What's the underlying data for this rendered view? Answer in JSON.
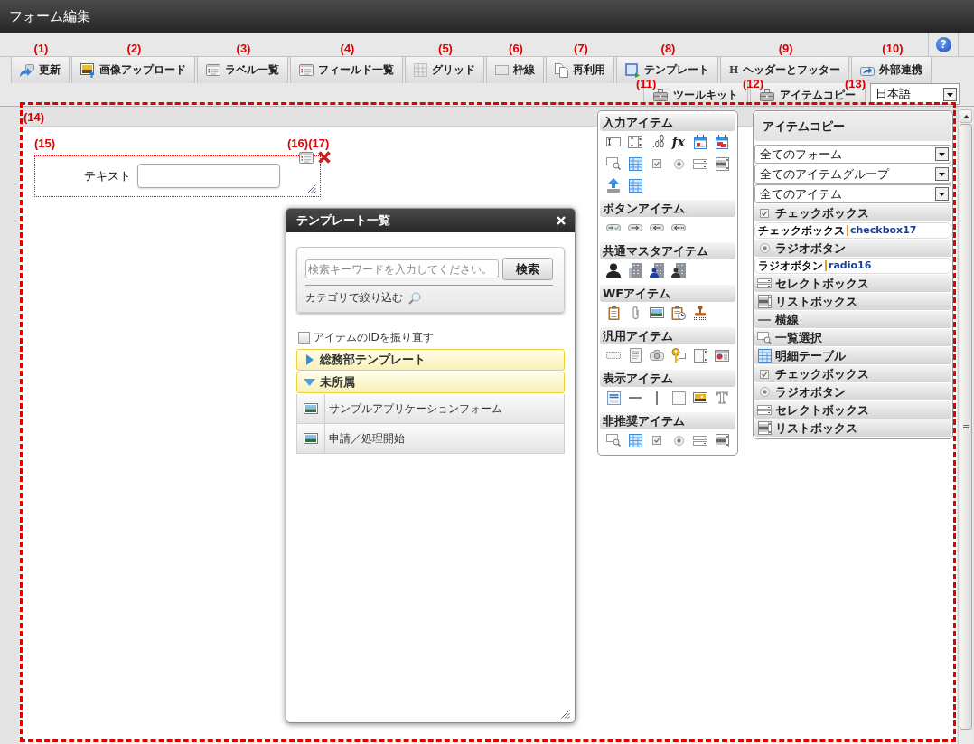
{
  "window": {
    "title": "フォーム編集"
  },
  "toolbar": {
    "help": {
      "glyph": "?"
    },
    "buttons": [
      {
        "kind": "refresh",
        "label": "更新",
        "marker": "(1)"
      },
      {
        "kind": "imageupload",
        "label": "画像アップロード",
        "marker": "(2)"
      },
      {
        "kind": "listwindow",
        "label": "ラベル一覧",
        "marker": "(3)"
      },
      {
        "kind": "listwindow",
        "label": "フィールド一覧",
        "marker": "(4)"
      },
      {
        "kind": "grid",
        "label": "グリッド",
        "marker": "(5)"
      },
      {
        "kind": "border",
        "label": "枠線",
        "marker": "(6)"
      },
      {
        "kind": "pages",
        "label": "再利用",
        "marker": "(7)"
      },
      {
        "kind": "template",
        "label": "テンプレート",
        "marker": "(8)"
      },
      {
        "kind": "glyph",
        "glyph": "H",
        "label": "ヘッダーとフッター",
        "marker": "(9)"
      },
      {
        "kind": "share",
        "label": "外部連携",
        "marker": "(10)"
      }
    ],
    "panel_tabs": [
      {
        "label": "ツールキット",
        "marker": "(11)"
      },
      {
        "label": "アイテムコピー",
        "marker": "(12)"
      }
    ],
    "language": {
      "value": "日本語",
      "marker": "(13)"
    }
  },
  "canvas": {
    "marker": "(14)",
    "item": {
      "marker": "(15)",
      "label": "テキスト",
      "actions": [
        {
          "kind": "properties",
          "marker": "(16)"
        },
        {
          "kind": "delete",
          "marker": "(17)"
        }
      ]
    }
  },
  "template_dialog": {
    "title": "テンプレート一覧",
    "search": {
      "placeholder": "検索キーワードを入力してください。",
      "button": "検索"
    },
    "filter_link": "カテゴリで絞り込む",
    "renumber": {
      "label": "アイテムのIDを振り直す",
      "checked": false
    },
    "categories": [
      {
        "label": "総務部テンプレート",
        "expanded": false
      },
      {
        "label": "未所属",
        "expanded": true,
        "children": [
          {
            "label": "サンプルアプリケーションフォーム"
          },
          {
            "label": "申請／処理開始"
          }
        ]
      }
    ]
  },
  "toolkit": {
    "sections": [
      {
        "title": "入力アイテム",
        "items": [
          {
            "kind": "textbox"
          },
          {
            "kind": "textarea"
          },
          {
            "kind": "number",
            "glyph": ".0 .00"
          },
          {
            "kind": "formula",
            "glyph": "fx"
          },
          {
            "kind": "date"
          },
          {
            "kind": "daterange"
          },
          {
            "kind": "lookup"
          },
          {
            "kind": "table"
          },
          {
            "kind": "checkbox"
          },
          {
            "kind": "radio"
          },
          {
            "kind": "select"
          },
          {
            "kind": "listbox"
          },
          {
            "kind": "upload"
          },
          {
            "kind": "table"
          }
        ]
      },
      {
        "title": "ボタンアイテム",
        "items": [
          {
            "kind": "btncheck"
          },
          {
            "kind": "btnnext"
          },
          {
            "kind": "btnback"
          },
          {
            "kind": "btnbackdots"
          }
        ]
      },
      {
        "title": "共通マスタアイテム",
        "items": [
          {
            "kind": "person"
          },
          {
            "kind": "building"
          },
          {
            "kind": "buildingperson"
          },
          {
            "kind": "buildingperson2"
          }
        ]
      },
      {
        "title": "WFアイテム",
        "items": [
          {
            "kind": "clipboard"
          },
          {
            "kind": "paperclip"
          },
          {
            "kind": "image"
          },
          {
            "kind": "clipclock"
          },
          {
            "kind": "stamp"
          }
        ]
      },
      {
        "title": "汎用アイテム",
        "items": [
          {
            "kind": "dashedbox"
          },
          {
            "kind": "document"
          },
          {
            "kind": "camera"
          },
          {
            "kind": "key"
          },
          {
            "kind": "sidepanel"
          },
          {
            "kind": "chartwindow"
          }
        ]
      },
      {
        "title": "表示アイテム",
        "items": [
          {
            "kind": "textblock"
          },
          {
            "kind": "hline"
          },
          {
            "kind": "vline"
          },
          {
            "kind": "blank"
          },
          {
            "kind": "picture"
          },
          {
            "kind": "letter",
            "glyph": "T"
          }
        ]
      },
      {
        "title": "非推奨アイテム",
        "items": [
          {
            "kind": "lookup"
          },
          {
            "kind": "table"
          },
          {
            "kind": "checkbox"
          },
          {
            "kind": "radio"
          },
          {
            "kind": "select"
          },
          {
            "kind": "listbox"
          }
        ]
      }
    ]
  },
  "item_copy": {
    "title": "アイテムコピー",
    "filters": [
      {
        "value": "全てのフォーム"
      },
      {
        "value": "全てのアイテムグループ"
      },
      {
        "value": "全てのアイテム"
      }
    ],
    "rows": [
      {
        "kind": "checkbox",
        "label": "チェックボックス"
      },
      {
        "kind": "detail",
        "label": "チェックボックス",
        "id": "checkbox17"
      },
      {
        "kind": "radio",
        "label": "ラジオボタン"
      },
      {
        "kind": "detail",
        "label": "ラジオボタン",
        "id": "radio16"
      },
      {
        "kind": "select",
        "label": "セレクトボックス"
      },
      {
        "kind": "listbox",
        "label": "リストボックス"
      },
      {
        "kind": "hline",
        "label": "横線"
      },
      {
        "kind": "lookup",
        "label": "一覧選択"
      },
      {
        "kind": "table",
        "label": "明細テーブル"
      },
      {
        "kind": "checkbox",
        "label": "チェックボックス"
      },
      {
        "kind": "radio",
        "label": "ラジオボタン"
      },
      {
        "kind": "select",
        "label": "セレクトボックス"
      },
      {
        "kind": "listbox",
        "label": "リストボックス"
      }
    ]
  }
}
